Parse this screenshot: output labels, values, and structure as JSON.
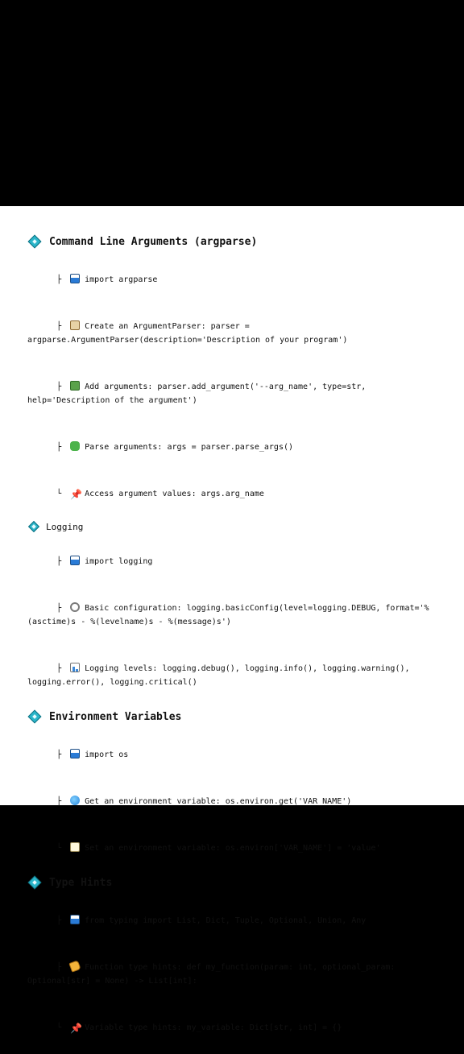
{
  "sections": [
    {
      "title": "Command Line Arguments (argparse)",
      "items": [
        {
          "branch": "├",
          "icon": "inbox-tray-icon",
          "text": "import argparse"
        },
        {
          "branch": "├",
          "icon": "clipboard-icon",
          "text": "Create an ArgumentParser: parser = argparse.ArgumentParser(description='Description of your program')"
        },
        {
          "branch": "├",
          "icon": "book-icon",
          "text": "Add arguments: parser.add_argument('--arg_name', type=str, help='Description of the argument')"
        },
        {
          "branch": "├",
          "icon": "puzzle-icon",
          "text": "Parse arguments: args = parser.parse_args()"
        },
        {
          "branch": "└",
          "icon": "pushpin-icon",
          "text": "Access argument values: args.arg_name"
        }
      ]
    },
    {
      "title": "Logging",
      "items": [
        {
          "branch": "├",
          "icon": "inbox-tray-icon",
          "text": "import logging"
        },
        {
          "branch": "├",
          "icon": "gear-icon",
          "text": "Basic configuration: logging.basicConfig(level=logging.DEBUG, format='%(asctime)s - %(levelname)s - %(message)s')"
        },
        {
          "branch": "├",
          "icon": "bar-chart-icon",
          "text": "Logging levels: logging.debug(), logging.info(), logging.warning(), logging.error(), logging.critical()"
        }
      ]
    },
    {
      "title": "Environment Variables",
      "items": [
        {
          "branch": "├",
          "icon": "inbox-tray-icon",
          "text": "import os"
        },
        {
          "branch": "├",
          "icon": "globe-icon",
          "text": "Get an environment variable: os.environ.get('VAR_NAME')"
        },
        {
          "branch": "└",
          "icon": "memo-icon",
          "text": "Set an environment variable: os.environ['VAR_NAME'] = 'value'"
        }
      ]
    },
    {
      "title": "Type Hints",
      "items": [
        {
          "branch": "├",
          "icon": "inbox-tray-icon",
          "text": "from typing import List, Dict, Tuple, Optional, Union, Any"
        },
        {
          "branch": "├",
          "icon": "label-tag-icon",
          "text": "Function type hints: def my_function(param: int, optional_param: Optional[str] = None) -> List[int]:"
        },
        {
          "branch": "└",
          "icon": "pushpin-icon",
          "text": "Variable type hints: my_variable: Dict[str, int] = {}"
        }
      ]
    }
  ],
  "colors": {
    "diamond": "#2bb5c9",
    "background": "#ffffff",
    "letterbox": "#000000"
  }
}
